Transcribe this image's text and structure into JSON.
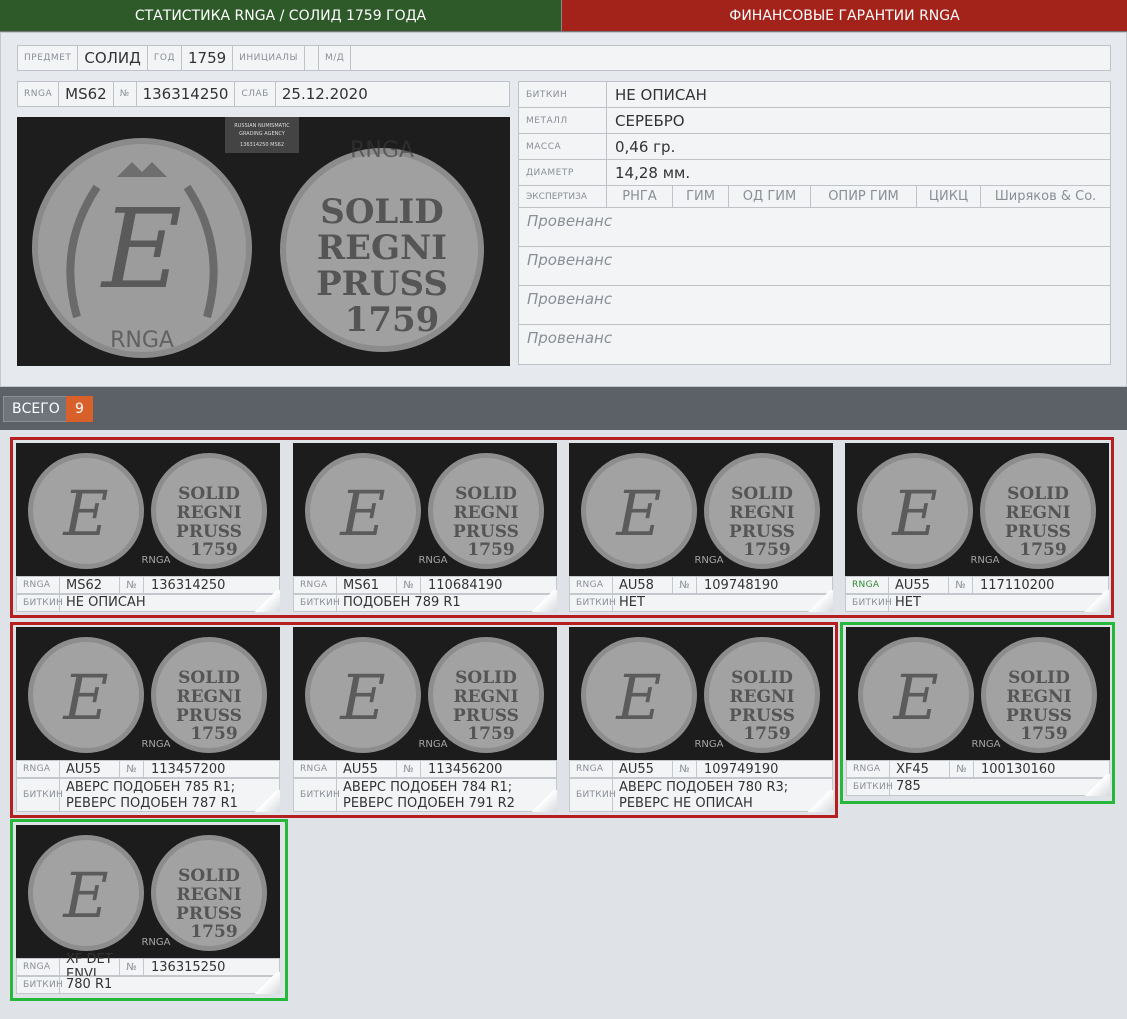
{
  "tabs": {
    "left": "СТАТИСТИКА RNGA  /  СОЛИД 1759 ГОДА",
    "right": "ФИНАНСОВЫЕ ГАРАНТИИ RNGA"
  },
  "item": {
    "predmet_label": "ПРЕДМЕТ",
    "predmet": "СОЛИД",
    "god_label": "ГОД",
    "god": "1759",
    "initials_label": "ИНИЦИАЛЫ",
    "initials": "",
    "md_label": "М/Д",
    "md": ""
  },
  "slab": {
    "rnga_label": "RNGA",
    "grade": "MS62",
    "no_label": "№",
    "number": "136314250",
    "slab_label": "СЛАБ",
    "date": "25.12.2020"
  },
  "specs": {
    "bitkin_label": "БИТКИН",
    "bitkin": "НЕ ОПИСАН",
    "metal_label": "МЕТАЛЛ",
    "metal": "СЕРЕБРО",
    "mass_label": "МАССА",
    "mass": "0,46 гр.",
    "diam_label": "ДИАМЕТР",
    "diam": "14,28 мм.",
    "exp_label": "ЭКСПЕРТИЗА",
    "expertise": [
      "РНГА",
      "ГИМ",
      "ОД ГИМ",
      "ОПИР ГИМ",
      "ЦИКЦ",
      "Ширяков & Co."
    ],
    "provenance": [
      "Провенанс",
      "Провенанс",
      "Провенанс",
      "Провенанс"
    ]
  },
  "total": {
    "label": "ВСЕГО",
    "count": "9"
  },
  "card_labels": {
    "rnga": "RNGA",
    "no": "№",
    "bitkin": "БИТКИН"
  },
  "cards": [
    {
      "grade": "MS62",
      "number": "136314250",
      "bitkin": "НЕ ОПИСАН"
    },
    {
      "grade": "MS61",
      "number": "110684190",
      "bitkin": "ПОДОБЕН 789 R1"
    },
    {
      "grade": "AU58",
      "number": "109748190",
      "bitkin": "НЕТ"
    },
    {
      "grade": "AU55",
      "number": "117110200",
      "bitkin": "НЕТ"
    },
    {
      "grade": "AU55",
      "number": "113457200",
      "bitkin": "АВЕРС ПОДОБЕН 785 R1; РЕВЕРС ПОДОБЕН 787 R1"
    },
    {
      "grade": "AU55",
      "number": "113456200",
      "bitkin": "АВЕРС ПОДОБЕН 784 R1; РЕВЕРС ПОДОБЕН 791 R2"
    },
    {
      "grade": "AU55",
      "number": "109749190",
      "bitkin": "АВЕРС ПОДОБЕН 780 R3; РЕВЕРС НЕ ОПИСАН"
    },
    {
      "grade": "XF45",
      "number": "100130160",
      "bitkin": "785"
    },
    {
      "grade": "XF DET ENVI...",
      "number": "136315250",
      "bitkin": "780 R1"
    }
  ],
  "coin_text": {
    "reverse": [
      "SOLID",
      "REGNI",
      "PRUSS",
      "1759"
    ],
    "watermark": "RNGA",
    "label_lines": [
      "RUSSIAN NUMISMATIC",
      "GRADING AGENCY",
      "136314250 MS62"
    ]
  },
  "colors": {
    "green_tab": "#2e5a2a",
    "red_tab": "#a3221a",
    "red_group": "#b51f1f",
    "green_group": "#26b83a",
    "count_badge": "#d8602b"
  }
}
